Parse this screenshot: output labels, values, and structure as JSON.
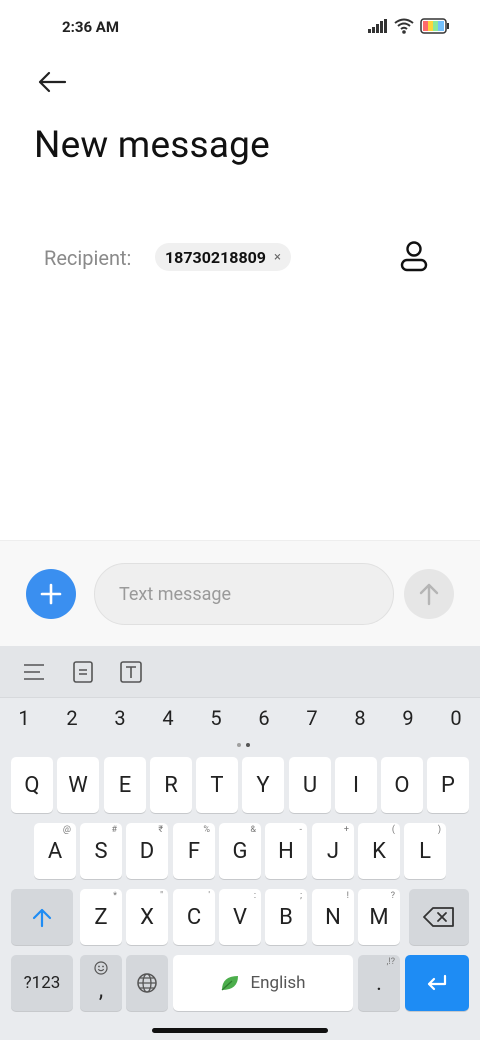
{
  "status_bar": {
    "time": "2:36 AM"
  },
  "header": {
    "title": "New message"
  },
  "recipient": {
    "label": "Recipient:",
    "number": "18730218809",
    "remove_glyph": "×"
  },
  "compose": {
    "placeholder": "Text message"
  },
  "keyboard": {
    "numbers": [
      "1",
      "2",
      "3",
      "4",
      "5",
      "6",
      "7",
      "8",
      "9",
      "0"
    ],
    "row1": [
      "Q",
      "W",
      "E",
      "R",
      "T",
      "Y",
      "U",
      "I",
      "O",
      "P"
    ],
    "row2": [
      {
        "key": "A",
        "hint": "@"
      },
      {
        "key": "S",
        "hint": "#"
      },
      {
        "key": "D",
        "hint": "₹"
      },
      {
        "key": "F",
        "hint": "%"
      },
      {
        "key": "G",
        "hint": "&"
      },
      {
        "key": "H",
        "hint": "-"
      },
      {
        "key": "J",
        "hint": "+"
      },
      {
        "key": "K",
        "hint": "("
      },
      {
        "key": "L",
        "hint": ")"
      }
    ],
    "row3": [
      {
        "key": "Z",
        "hint": "*"
      },
      {
        "key": "X",
        "hint": "\""
      },
      {
        "key": "C",
        "hint": "'"
      },
      {
        "key": "V",
        "hint": ":"
      },
      {
        "key": "B",
        "hint": ";"
      },
      {
        "key": "N",
        "hint": "!"
      },
      {
        "key": "M",
        "hint": "?"
      }
    ],
    "symbols_label": "?123",
    "comma_label": ",",
    "space_label": "English",
    "period_label": ".",
    "period_hint": ",!?"
  },
  "colors": {
    "accent": "#3a8ff0",
    "enter_key": "#1e8cf4"
  },
  "icons": {
    "back": "arrow-left-icon",
    "contact": "person-icon",
    "add": "plus-icon",
    "send": "arrow-up-icon",
    "shift": "shift-arrow-icon",
    "backspace": "backspace-icon",
    "globe": "globe-icon",
    "enter": "enter-icon",
    "emoji": "emoji-icon"
  }
}
